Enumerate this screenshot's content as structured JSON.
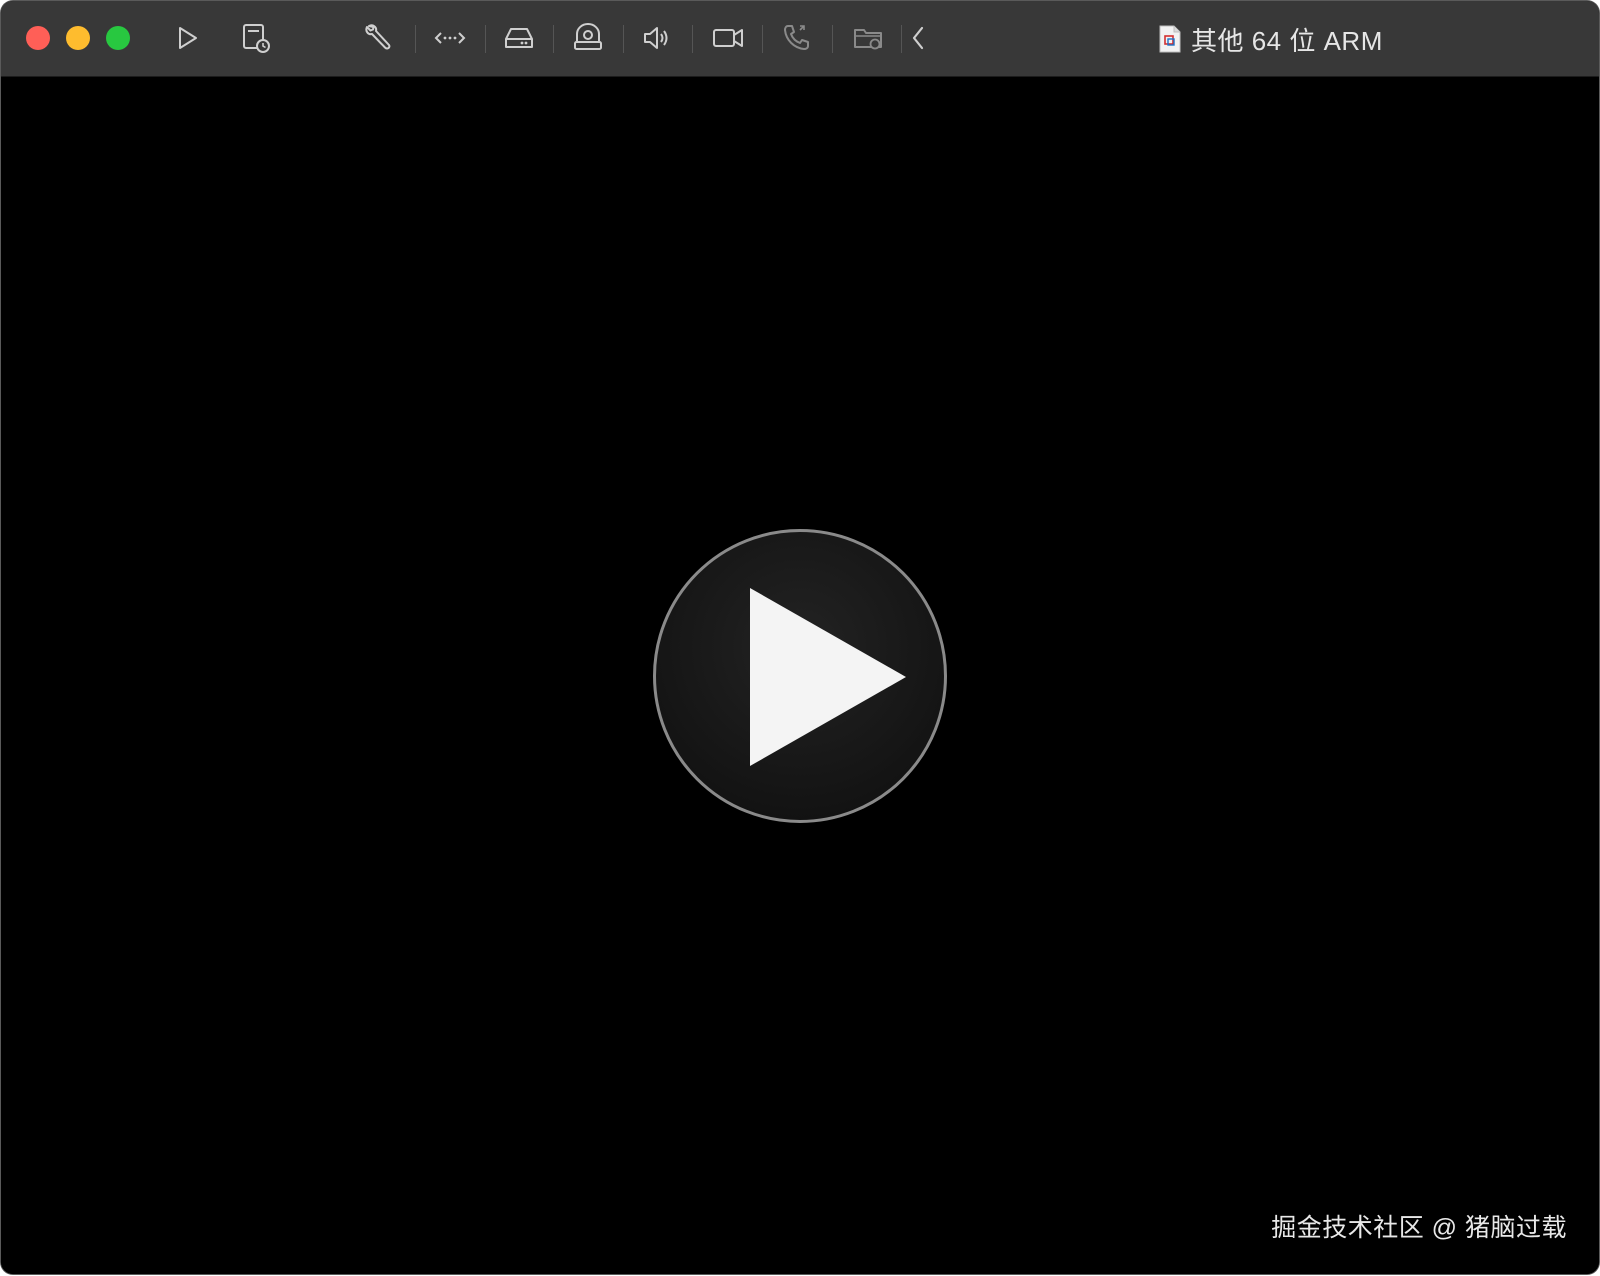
{
  "window": {
    "title": "其他 64 位 ARM",
    "controls": [
      "close",
      "minimize",
      "maximize"
    ]
  },
  "toolbar": {
    "icons": [
      "play-icon",
      "snapshot-icon",
      "wrench-icon",
      "network-icon",
      "hard-disk-icon",
      "webcam-icon",
      "speaker-icon",
      "camera-icon",
      "phone-icon",
      "shared-folder-icon",
      "chevron-left-icon"
    ]
  },
  "colors": {
    "close": "#ff5f57",
    "minimize": "#febc2e",
    "maximize": "#28c840",
    "titlebar": "#383838",
    "viewport": "#000000"
  },
  "main": {
    "center_control": "play-button"
  },
  "watermark": {
    "text": "掘金技术社区 @ 猪脑过载"
  }
}
